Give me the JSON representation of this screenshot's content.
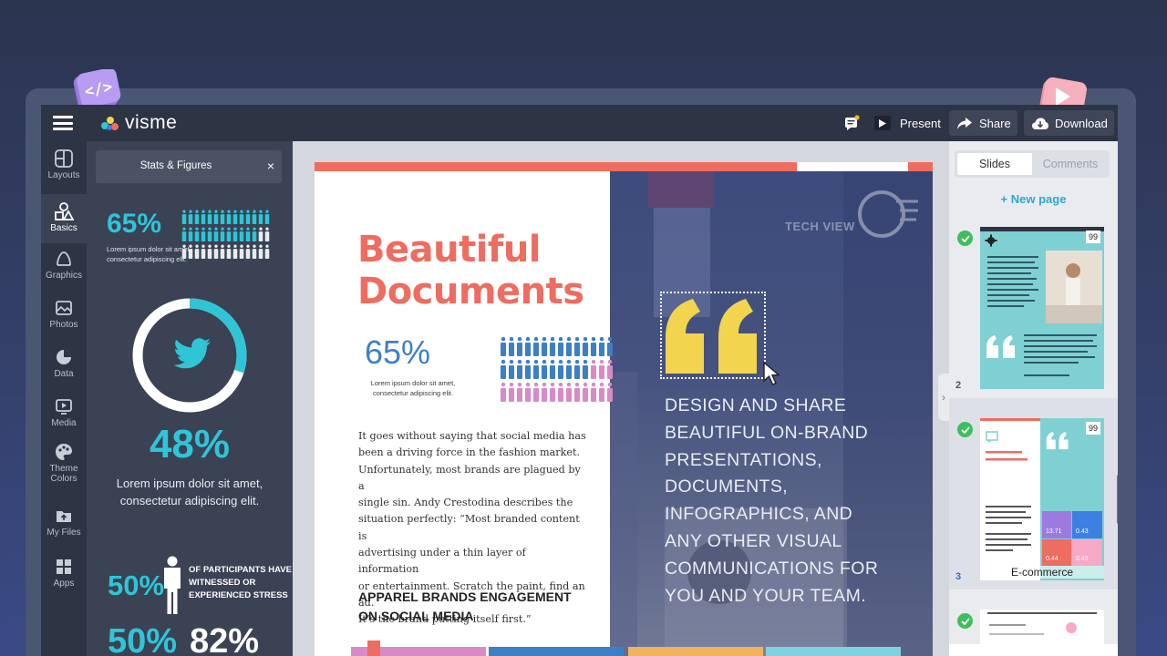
{
  "app": {
    "logo_text": "visme",
    "present_label": "Present",
    "share_label": "Share",
    "download_label": "Download"
  },
  "rail": [
    {
      "label": "Layouts",
      "icon": "layouts-icon"
    },
    {
      "label": "Basics",
      "icon": "basics-icon"
    },
    {
      "label": "Graphics",
      "icon": "graphics-icon"
    },
    {
      "label": "Photos",
      "icon": "photos-icon"
    },
    {
      "label": "Data",
      "icon": "data-icon"
    },
    {
      "label": "Media",
      "icon": "media-icon"
    },
    {
      "label": "Theme",
      "label2": "Colors",
      "icon": "palette-icon"
    },
    {
      "label": "My Files",
      "icon": "my-files-icon"
    },
    {
      "label": "Apps",
      "icon": "apps-icon"
    }
  ],
  "panel": {
    "title": "Stats & Figures",
    "close": "×",
    "stat1_value": "65%",
    "stat1_caption_l1": "Lorem ipsum dolor sit amet,",
    "stat1_caption_l2": "consectetur adipiscing elit.",
    "stat2_value": "48%",
    "stat2_caption_l1": "Lorem ipsum dolor sit amet,",
    "stat2_caption_l2": "consectetur adipiscing elit.",
    "stat2_ring_fraction": 0.3,
    "stat3_value": "50%",
    "stat3_caption_l1": "OF PARTICIPANTS HAVE",
    "stat3_caption_l2": "WITNESSED OR",
    "stat3_caption_l3": "EXPERIENCED STRESS",
    "stat4_value": "50%",
    "stat5_value": "82%"
  },
  "document": {
    "headline_l1": "Beautiful",
    "headline_l2": "Documents",
    "stat_value": "65%",
    "stat_caption_l1": "Lorem ipsum dolor sit amet,",
    "stat_caption_l2": "consectetur adipiscing elit.",
    "body_l1": "It goes without saying that social media has",
    "body_l2": "been a driving force in the fashion market.",
    "body_l3": "Unfortunately, most brands are plagued by a",
    "body_l4": "single sin. Andy Crestodina describes the",
    "body_l5": "situation perfectly: “Most branded content is",
    "body_l6": "advertising under a thin layer of information",
    "body_l7": "or entertainment. Scratch the paint, find an ad.",
    "body_l8": "It’s the brand putting itself first.”",
    "apparel_l1": "APPAREL BRANDS ENGAGEMENT",
    "apparel_l2": "ON SOCIAL MEDIA",
    "right_l1": "DESIGN AND SHARE",
    "right_l2": "BEAUTIFUL ON-BRAND",
    "right_l3": "PRESENTATIONS,",
    "right_l4": "DOCUMENTS,",
    "right_l5": "INFOGRAPHICS, AND",
    "right_l6": "ANY OTHER VISUAL",
    "right_l7": "COMMUNICATIONS FOR",
    "right_l8": "YOU AND YOUR TEAM.",
    "watermark_latin": "TECH VIEW",
    "colors": {
      "coral": "#ee6c60",
      "blue": "#3d7fc7",
      "pink": "#d989c8",
      "yellow": "#f2d44e"
    }
  },
  "slides": {
    "tab_slides": "Slides",
    "tab_comments": "Comments",
    "new_page": "+ New page",
    "items": [
      {
        "number": "2",
        "badge": "99"
      },
      {
        "number": "3",
        "badge": "99",
        "caption": "E-commerce",
        "metric_a": "13.71",
        "metric_b": "0.43",
        "metric_c": "0.44",
        "metric_d": "0.43"
      }
    ]
  }
}
